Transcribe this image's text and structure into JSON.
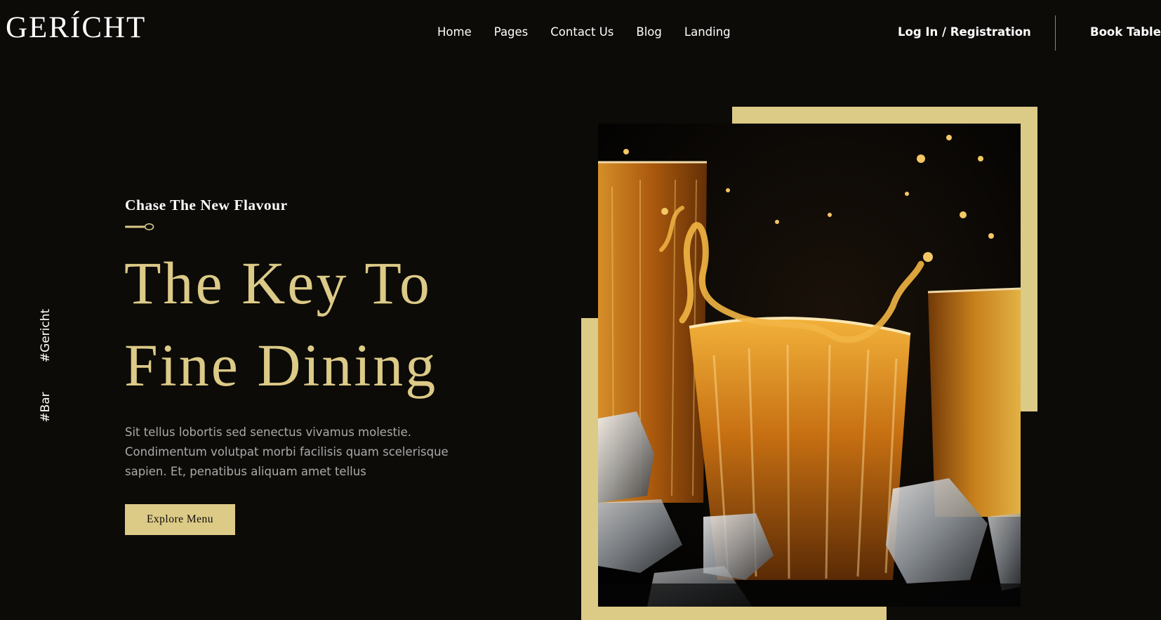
{
  "header": {
    "logo": "GERÍCHT",
    "nav": [
      "Home",
      "Pages",
      "Contact Us",
      "Blog",
      "Landing"
    ],
    "login_label": "Log In / Registration",
    "book_label": "Book Table"
  },
  "side_tags": [
    "#Gericht",
    "#Bar"
  ],
  "hero": {
    "subtitle": "Chase The New Flavour",
    "headline_line1": "The Key To",
    "headline_line2": "Fine Dining",
    "description": "Sit tellus lobortis sed senectus vivamus molestie. Condimentum volutpat morbi facilisis quam scelerisque sapien. Et, penatibus aliquam amet tellus",
    "button_label": "Explore Menu"
  },
  "colors": {
    "background": "#0c0b08",
    "accent_gold": "#dcca87",
    "text_white": "#ffffff",
    "text_gray": "#aaaaaa"
  },
  "icons": {
    "divider": "spoon-icon"
  }
}
